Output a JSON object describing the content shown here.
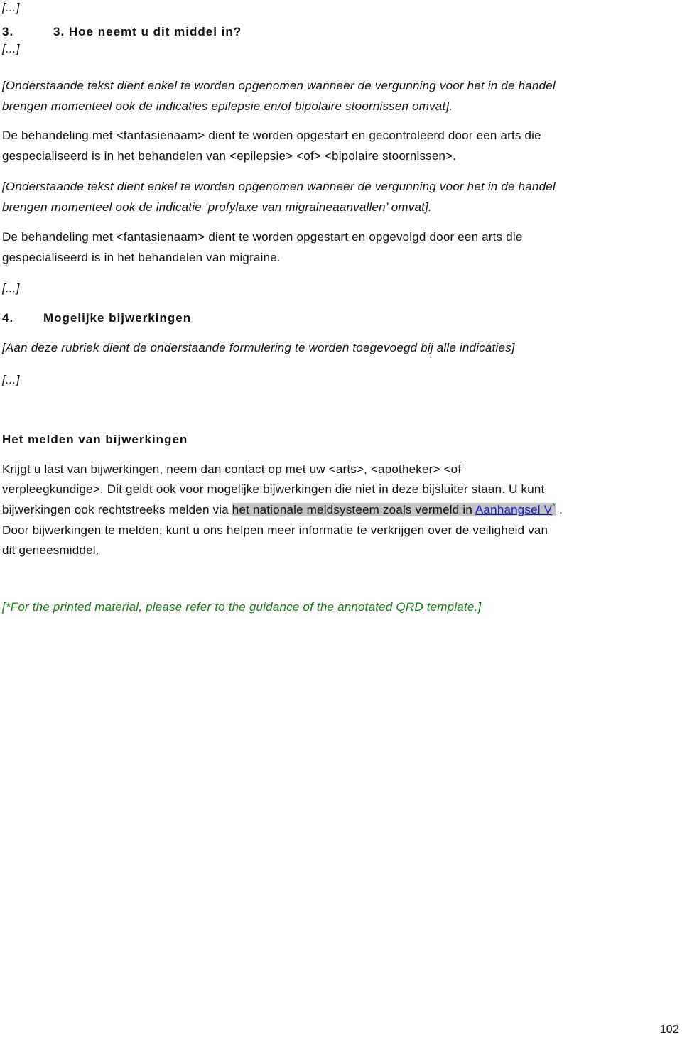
{
  "ellipsis": "[...]",
  "section3": {
    "number": "3.",
    "title": "3. Hoe neemt u dit middel in?"
  },
  "para1": {
    "note_lines": [
      " [Onderstaande tekst dient enkel te worden opgenomen wanneer de vergunning voor het in de handel",
      "brengen momenteel ook de indicaties epilepsie en/of bipolaire stoornissen omvat]."
    ],
    "body_lines": [
      "De behandeling met <fantasienaam> dient te worden opgestart en gecontroleerd door een arts die",
      "gespecialiseerd is in het behandelen van <epilepsie> <of> <bipolaire stoornissen>."
    ]
  },
  "para2": {
    "note_lines": [
      "[Onderstaande tekst dient enkel te worden opgenomen wanneer de vergunning voor het in de handel",
      "brengen momenteel ook de indicatie ‘profylaxe van migraineaanvallen’ omvat]."
    ],
    "body_lines": [
      "De behandeling met <fantasienaam> dient te worden opgestart en opgevolgd door een arts die",
      "gespecialiseerd is in het behandelen van migraine."
    ]
  },
  "section4": {
    "number": "4.",
    "title": "Mogelijke bijwerkingen",
    "note": "[Aan deze rubriek dient de onderstaande formulering te worden toegevoegd bij alle indicaties]"
  },
  "reporting": {
    "heading": "Het melden van bijwerkingen",
    "line1": "Krijgt u last van bijwerkingen, neem dan contact op met uw <arts>, <apotheker> <of",
    "line2": "verpleegkundige>. Dit geldt ook voor mogelijke bijwerkingen die niet in deze bijsluiter staan. U kunt",
    "line3_pre": "bijwerkingen ook rechtstreeks melden via ",
    "line3_highlight": "het nationale meldsysteem zoals vermeld in ",
    "link_text": "Aanhangsel V",
    "asterisk": "*",
    "line3_post": " .",
    "line4": "Door bijwerkingen te melden, kunt u ons helpen meer informatie te verkrijgen over de veiligheid van",
    "line5": "dit geneesmiddel."
  },
  "footnote": "[*For the printed material, please refer to the guidance of the annotated QRD template.]",
  "page_number": "102",
  "colors": {
    "text": "#111111",
    "green_note": "#1a7a1a",
    "link": "#1a1ad0",
    "highlight": "#c4c4c4"
  }
}
